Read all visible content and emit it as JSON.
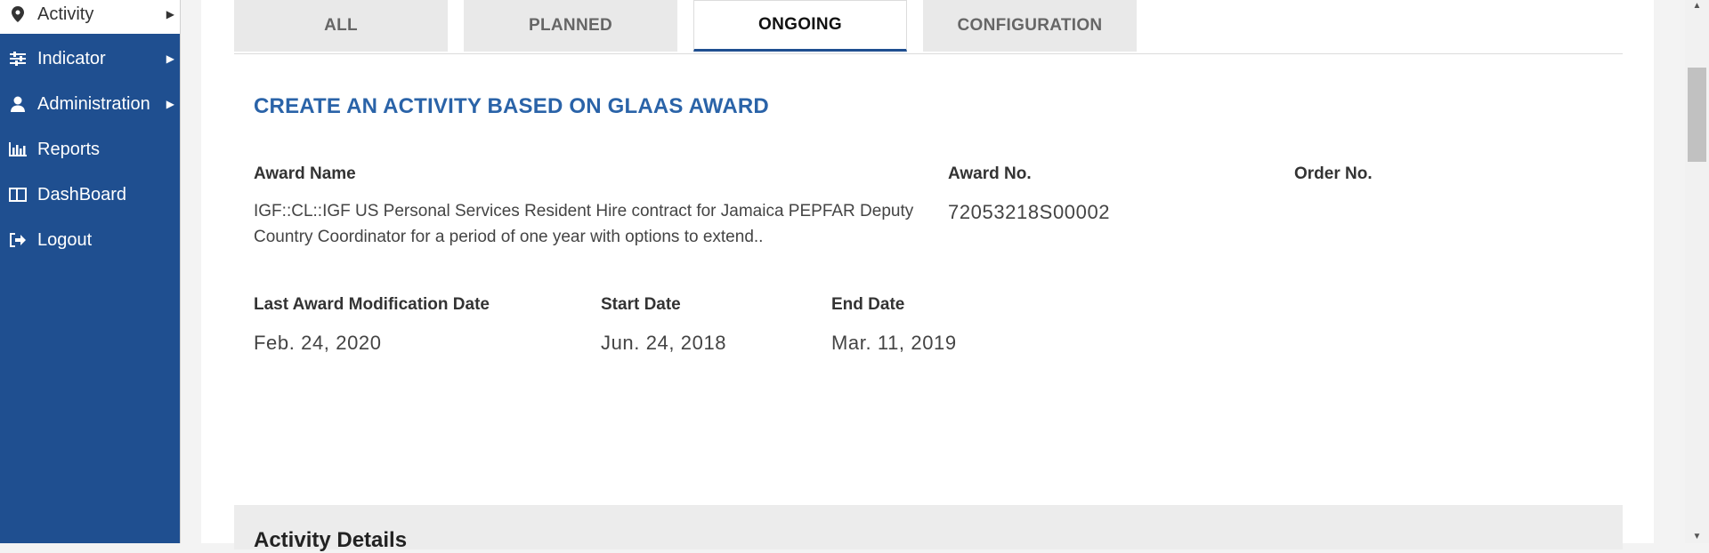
{
  "sidebar": {
    "items": [
      {
        "label": "Activity",
        "icon": "map-pin-icon",
        "has_submenu": true
      },
      {
        "label": "Indicator",
        "icon": "sliders-icon",
        "has_submenu": true
      },
      {
        "label": "Administration",
        "icon": "user-icon",
        "has_submenu": true
      },
      {
        "label": "Reports",
        "icon": "bar-chart-icon",
        "has_submenu": false
      },
      {
        "label": "DashBoard",
        "icon": "dashboard-icon",
        "has_submenu": false
      },
      {
        "label": "Logout",
        "icon": "sign-out-icon",
        "has_submenu": false
      }
    ]
  },
  "tabs": [
    {
      "label": "ALL",
      "active": false
    },
    {
      "label": "PLANNED",
      "active": false
    },
    {
      "label": "ONGOING",
      "active": true
    },
    {
      "label": "CONFIGURATION",
      "active": false
    }
  ],
  "section": {
    "title": "CREATE AN ACTIVITY BASED ON GLAAS AWARD"
  },
  "award": {
    "name_label": "Award Name",
    "name_value": "IGF::CL::IGF US Personal Services Resident Hire contract for Jamaica PEPFAR Deputy Country Coordinator for a period of one year with options to extend..",
    "number_label": "Award No.",
    "number_value": "72053218S00002",
    "order_label": "Order No.",
    "order_value": "",
    "last_mod_label": "Last Award Modification Date",
    "last_mod_value": "Feb. 24, 2020",
    "start_label": "Start Date",
    "start_value": "Jun. 24, 2018",
    "end_label": "End Date",
    "end_value": "Mar. 11, 2019"
  },
  "details": {
    "title": "Activity Details"
  },
  "colors": {
    "sidebar_bg": "#1f4f90",
    "accent": "#2a63a8"
  }
}
